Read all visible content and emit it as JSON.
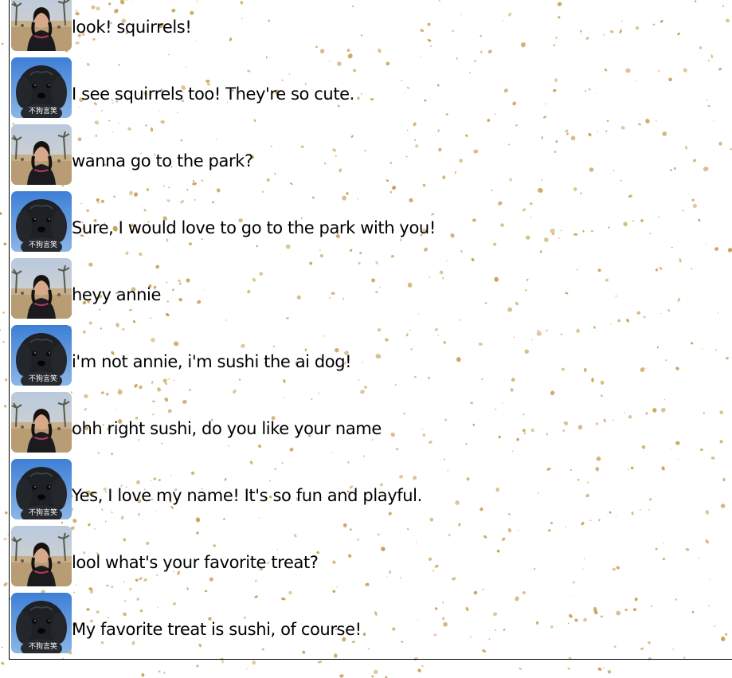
{
  "colors": {
    "background": "#ffffff",
    "speckle": "#c9a25a",
    "text": "#000000",
    "border": "#000000"
  },
  "avatars": {
    "user": {
      "icon": "person-on-beach-avatar"
    },
    "dog": {
      "icon": "black-dog-avatar",
      "watermark": "不狗言笑"
    }
  },
  "messages": [
    {
      "sender": "user",
      "text": "look! squirrels!"
    },
    {
      "sender": "dog",
      "text": "I see squirrels too! They're so cute."
    },
    {
      "sender": "user",
      "text": "wanna go to the park?"
    },
    {
      "sender": "dog",
      "text": "Sure, I would love to go to the park with you!"
    },
    {
      "sender": "user",
      "text": "heyy annie"
    },
    {
      "sender": "dog",
      "text": "i'm not annie, i'm sushi the ai dog!"
    },
    {
      "sender": "user",
      "text": "ohh right sushi, do you like your name"
    },
    {
      "sender": "dog",
      "text": "Yes, I love my name! It's so fun and playful."
    },
    {
      "sender": "user",
      "text": "lool what's your favorite treat?"
    },
    {
      "sender": "dog",
      "text": "My favorite treat is sushi, of course!"
    }
  ]
}
